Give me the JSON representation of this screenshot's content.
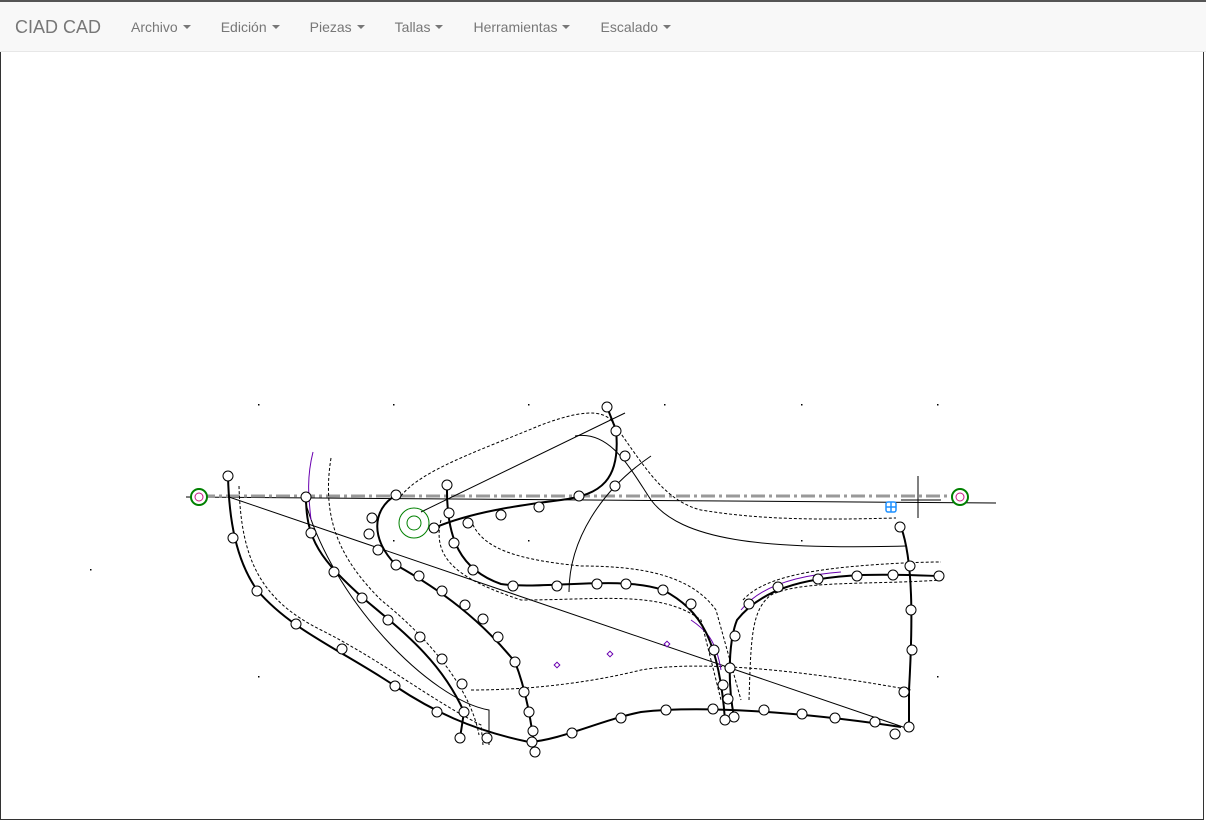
{
  "app": {
    "brand": "CIAD CAD"
  },
  "menu": {
    "items": [
      {
        "label": "Archivo"
      },
      {
        "label": "Edición"
      },
      {
        "label": "Piezas"
      },
      {
        "label": "Tallas"
      },
      {
        "label": "Herramientas"
      },
      {
        "label": "Escalado"
      }
    ]
  },
  "colors": {
    "navbar_bg": "#f8f8f8",
    "menu_text": "#777777",
    "outline": "#000000",
    "dashed_guide": "#999999",
    "axis_point": "#008000",
    "origin_point": "#008000",
    "cursor_marker": "#1e90ff",
    "purple_curve": "#6a00b0"
  },
  "icons": [
    "caret-down-icon",
    "crosshair-cursor-icon",
    "axis-end-target-icon",
    "origin-target-icon"
  ]
}
